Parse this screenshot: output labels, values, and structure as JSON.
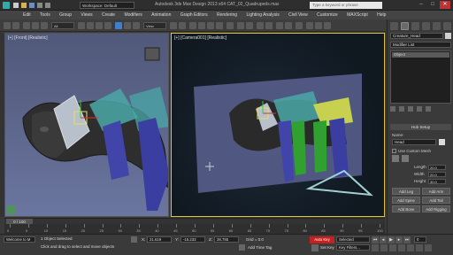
{
  "title_bar": {
    "workspace": "Workspace: Default",
    "title": "Autodesk 3ds Max Design 2013 x64   CAT_02_Quadrupeds.max",
    "search_placeholder": "Type a keyword or phrase",
    "min": "–",
    "max": "□",
    "close": "✕"
  },
  "menu": [
    "Edit",
    "Tools",
    "Group",
    "Views",
    "Create",
    "Modifiers",
    "Animation",
    "Graph Editors",
    "Rendering",
    "Lighting Analysis",
    "Civil View",
    "Customize",
    "MAXScript",
    "Help"
  ],
  "toolbar": {
    "filter": "All",
    "view": "View"
  },
  "viewports": {
    "left_label": "[+] [Front] [Realistic]",
    "right_label": "[+] [Camera001] [Realistic]"
  },
  "command_panel": {
    "object_name": "Creature_Head",
    "modifier_list": "Modifier List",
    "stack_item": "Object",
    "rollout": "Hub Setup",
    "name_label": "Name:",
    "name_value": "Head",
    "custom_mesh": "Use Custom Mesh",
    "length_label": "Length",
    "length_value": "20.0",
    "width_label": "Width",
    "width_value": "20.0",
    "height_label": "Height",
    "height_value": "30.0",
    "buttons": [
      "Add Leg",
      "Add Arm",
      "Add Spine",
      "Add Tail",
      "Add Bone",
      "Add Rigging"
    ]
  },
  "timeline": {
    "frame": "0 / 100",
    "ticks": [
      "0",
      "5",
      "10",
      "15",
      "20",
      "25",
      "30",
      "35",
      "40",
      "45",
      "50",
      "55",
      "60",
      "65",
      "70",
      "75",
      "80",
      "85",
      "90",
      "95",
      "100"
    ]
  },
  "status": {
    "welcome": "Welcome to M",
    "selected": "1 Object Selected",
    "hint": "Click and drag to select and move objects",
    "x_label": "X:",
    "x_value": "21.619",
    "y_label": "Y:",
    "y_value": "-15.233",
    "z_label": "Z:",
    "z_value": "28.755",
    "grid": "Grid = 0.0",
    "add_time_tag": "Add Time Tag",
    "auto_key": "Auto Key",
    "selected_dd": "Selected",
    "set_key": "Set Key",
    "key_filters": "Key Filters...",
    "frame_value": "0"
  },
  "colors": {
    "accent": "#3f7fd0",
    "autokey": "#c82020",
    "viewport_active": "#e0c040"
  }
}
